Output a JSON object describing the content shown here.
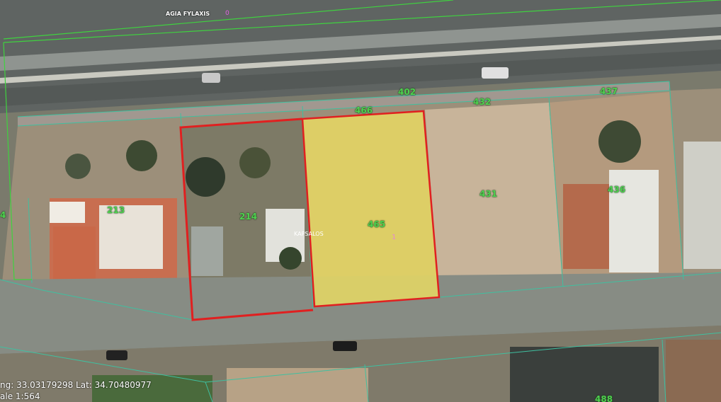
{
  "map": {
    "road_label": "AGIA FYLAXIS",
    "road_number": "0",
    "street_label": "KAPSALOS",
    "sheet_number": "1",
    "parcels": [
      {
        "id": "402"
      },
      {
        "id": "466"
      },
      {
        "id": "432"
      },
      {
        "id": "437"
      },
      {
        "id": "213"
      },
      {
        "id": "214"
      },
      {
        "id": "465"
      },
      {
        "id": "431"
      },
      {
        "id": "436"
      },
      {
        "id": "4"
      },
      {
        "id": "488"
      }
    ],
    "highlight_color": "#f0e060",
    "boundary_color": "#e02020",
    "parcel_line_color": "#3fc0a0"
  },
  "status": {
    "coords_text": "ng: 33.03179298 Lat: 34.70480977",
    "scale_text": "ale 1:564"
  }
}
